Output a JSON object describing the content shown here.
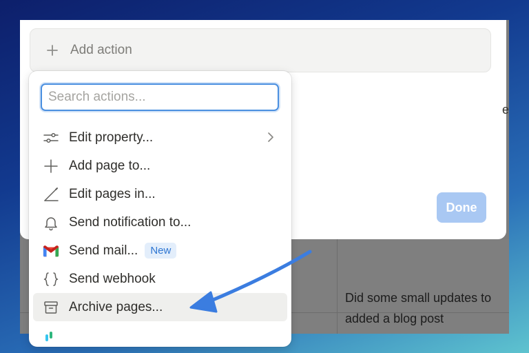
{
  "modal": {
    "add_action_label": "Add action",
    "done_label": "Done",
    "cut_text": "e"
  },
  "dropdown": {
    "search_placeholder": "Search actions...",
    "items": [
      {
        "label": "Edit property...",
        "icon": "sliders-icon",
        "has_submenu": true
      },
      {
        "label": "Add page to...",
        "icon": "plus-icon"
      },
      {
        "label": "Edit pages in...",
        "icon": "pencil-icon"
      },
      {
        "label": "Send notification to...",
        "icon": "bell-icon"
      },
      {
        "label": "Send mail...",
        "icon": "gmail-icon",
        "badge": "New"
      },
      {
        "label": "Send webhook",
        "icon": "braces-icon"
      },
      {
        "label": "Archive pages...",
        "icon": "archive-icon",
        "highlighted": true
      }
    ]
  },
  "background": {
    "cell_text": "Did some small updates to added a blog post"
  },
  "colors": {
    "accent": "#4a8fe0",
    "done_button": "#a9c8f3",
    "arrow": "#3b7de0",
    "new_badge_text": "#2f76d2"
  }
}
